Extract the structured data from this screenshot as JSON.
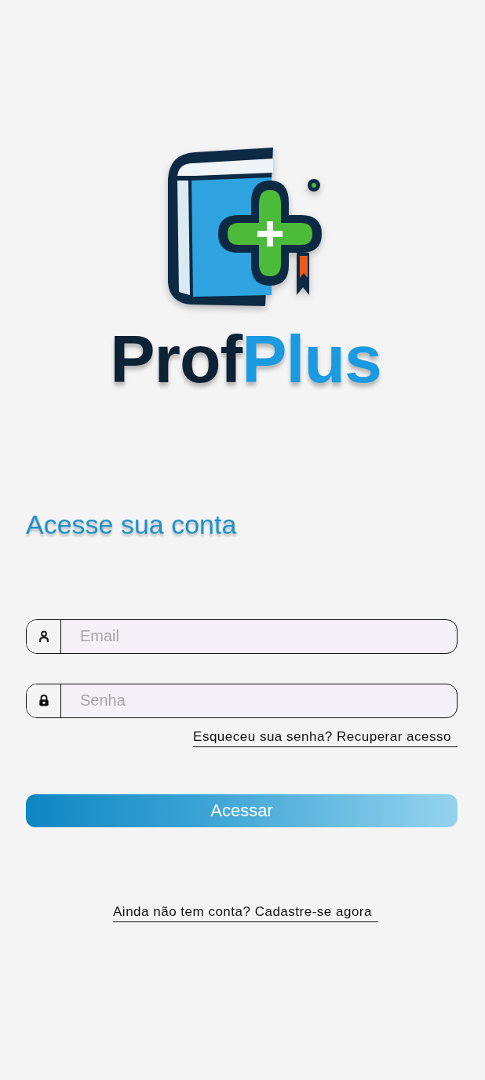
{
  "logo": {
    "wordmark_dark": "Prof",
    "wordmark_accent": "Plus"
  },
  "title": "Acesse sua conta",
  "fields": [
    {
      "kind": "email",
      "placeholder": "Email"
    },
    {
      "kind": "password",
      "placeholder": "Senha"
    }
  ],
  "forgot_link": "Esqueceu sua senha? Recuperar acesso",
  "submit_button": "Acessar",
  "signup_link": "Ainda não tem conta? Cadastre-se agora"
}
